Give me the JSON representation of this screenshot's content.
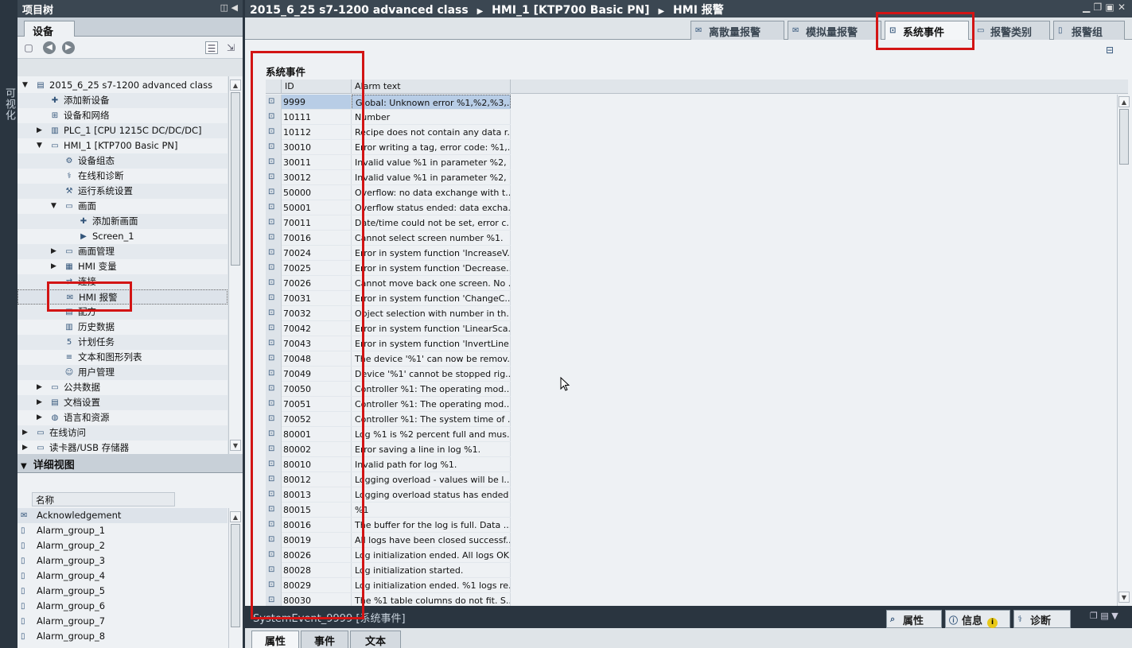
{
  "side_strip": {
    "label": "可视化"
  },
  "project_tree": {
    "title": "项目树",
    "tab": "设备",
    "nodes": [
      {
        "label": "2015_6_25 s7-1200 advanced class",
        "level": 0,
        "arrow": "▼",
        "icon": "project-icon"
      },
      {
        "label": "添加新设备",
        "level": 1,
        "arrow": "",
        "icon": "add-device-icon"
      },
      {
        "label": "设备和网络",
        "level": 1,
        "arrow": "",
        "icon": "network-icon"
      },
      {
        "label": "PLC_1 [CPU 1215C DC/DC/DC]",
        "level": 1,
        "arrow": "▶",
        "icon": "plc-icon"
      },
      {
        "label": "HMI_1 [KTP700 Basic PN]",
        "level": 1,
        "arrow": "▼",
        "icon": "hmi-icon"
      },
      {
        "label": "设备组态",
        "level": 2,
        "arrow": "",
        "icon": "device-config-icon"
      },
      {
        "label": "在线和诊断",
        "level": 2,
        "arrow": "",
        "icon": "diagnostics-icon"
      },
      {
        "label": "运行系统设置",
        "level": 2,
        "arrow": "",
        "icon": "runtime-settings-icon"
      },
      {
        "label": "画面",
        "level": 2,
        "arrow": "▼",
        "icon": "folder-icon"
      },
      {
        "label": "添加新画面",
        "level": 3,
        "arrow": "",
        "icon": "add-screen-icon"
      },
      {
        "label": "Screen_1",
        "level": 3,
        "arrow": "",
        "icon": "screen-icon"
      },
      {
        "label": "画面管理",
        "level": 2,
        "arrow": "▶",
        "icon": "folder-icon"
      },
      {
        "label": "HMI 变量",
        "level": 2,
        "arrow": "▶",
        "icon": "tags-icon"
      },
      {
        "label": "连接",
        "level": 2,
        "arrow": "",
        "icon": "connection-icon"
      },
      {
        "label": "HMI 报警",
        "level": 2,
        "arrow": "",
        "icon": "alarm-icon"
      },
      {
        "label": "配方",
        "level": 2,
        "arrow": "",
        "icon": "recipe-icon"
      },
      {
        "label": "历史数据",
        "level": 2,
        "arrow": "",
        "icon": "history-icon"
      },
      {
        "label": "计划任务",
        "level": 2,
        "arrow": "",
        "icon": "schedule-icon"
      },
      {
        "label": "文本和图形列表",
        "level": 2,
        "arrow": "",
        "icon": "text-list-icon"
      },
      {
        "label": "用户管理",
        "level": 2,
        "arrow": "",
        "icon": "user-admin-icon"
      },
      {
        "label": "公共数据",
        "level": 1,
        "arrow": "▶",
        "icon": "folder-icon"
      },
      {
        "label": "文档设置",
        "level": 1,
        "arrow": "▶",
        "icon": "document-settings-icon"
      },
      {
        "label": "语言和资源",
        "level": 1,
        "arrow": "▶",
        "icon": "language-icon"
      },
      {
        "label": "在线访问",
        "level": 0,
        "arrow": "▶",
        "icon": "online-access-icon"
      },
      {
        "label": "读卡器/USB 存储器",
        "level": 0,
        "arrow": "▶",
        "icon": "card-reader-icon"
      }
    ]
  },
  "detail_view": {
    "title": "详细视图",
    "column": "名称",
    "items": [
      "Acknowledgement",
      "Alarm_group_1",
      "Alarm_group_2",
      "Alarm_group_3",
      "Alarm_group_4",
      "Alarm_group_5",
      "Alarm_group_6",
      "Alarm_group_7",
      "Alarm_group_8"
    ]
  },
  "main": {
    "breadcrumb": [
      "2015_6_25 s7-1200 advanced class",
      "HMI_1 [KTP700 Basic PN]",
      "HMI 报警"
    ],
    "tabs": [
      {
        "label": "离散量报警",
        "active": false
      },
      {
        "label": "模拟量报警",
        "active": false
      },
      {
        "label": "系统事件",
        "active": true
      },
      {
        "label": "报警类别",
        "active": false
      },
      {
        "label": "报警组",
        "active": false
      }
    ],
    "section_title": "系统事件",
    "columns": {
      "id": "ID",
      "text": "Alarm text"
    },
    "rows": [
      {
        "id": "9999",
        "text": "Global: Unknown error %1,%2,%3,..."
      },
      {
        "id": "10111",
        "text": "Number"
      },
      {
        "id": "10112",
        "text": "Recipe does not contain any data r..."
      },
      {
        "id": "30010",
        "text": "Error writing a tag, error code: %1,..."
      },
      {
        "id": "30011",
        "text": "Invalid value %1 in parameter %2, ..."
      },
      {
        "id": "30012",
        "text": "Invalid value %1 in parameter %2, ..."
      },
      {
        "id": "50000",
        "text": "Overflow: no data exchange with t..."
      },
      {
        "id": "50001",
        "text": "Overflow status ended: data excha..."
      },
      {
        "id": "70011",
        "text": "Date/time could not be set, error c..."
      },
      {
        "id": "70016",
        "text": "Cannot select screen number %1."
      },
      {
        "id": "70024",
        "text": "Error in system function 'IncreaseV..."
      },
      {
        "id": "70025",
        "text": "Error in system function 'Decrease..."
      },
      {
        "id": "70026",
        "text": "Cannot move back one screen. No ..."
      },
      {
        "id": "70031",
        "text": "Error in system function 'ChangeC..."
      },
      {
        "id": "70032",
        "text": "Object selection with number in th..."
      },
      {
        "id": "70042",
        "text": "Error in system function 'LinearSca..."
      },
      {
        "id": "70043",
        "text": "Error in system function 'InvertLine..."
      },
      {
        "id": "70048",
        "text": "The device '%1' can now be remov..."
      },
      {
        "id": "70049",
        "text": "Device '%1' cannot be stopped rig..."
      },
      {
        "id": "70050",
        "text": "Controller %1: The operating mod..."
      },
      {
        "id": "70051",
        "text": "Controller %1: The operating mod..."
      },
      {
        "id": "70052",
        "text": "Controller %1: The system time of ..."
      },
      {
        "id": "80001",
        "text": "Log %1 is %2 percent full and mus..."
      },
      {
        "id": "80002",
        "text": "Error saving a line in log %1."
      },
      {
        "id": "80010",
        "text": "Invalid path for log %1."
      },
      {
        "id": "80012",
        "text": "Logging overload - values will be l..."
      },
      {
        "id": "80013",
        "text": "Logging overload status has ended"
      },
      {
        "id": "80015",
        "text": "%1"
      },
      {
        "id": "80016",
        "text": "The buffer for the log is full. Data ..."
      },
      {
        "id": "80019",
        "text": "All logs have been closed successf..."
      },
      {
        "id": "80026",
        "text": "Log initialization ended. All logs OK."
      },
      {
        "id": "80028",
        "text": "Log initialization started."
      },
      {
        "id": "80029",
        "text": "Log initialization ended. %1 logs re..."
      },
      {
        "id": "80030",
        "text": "The %1 table columns do not fit. S..."
      }
    ],
    "selected_row": 0
  },
  "inspector": {
    "caption": "SystemEvent_9999 [系统事件]",
    "right_tabs": [
      "属性",
      "信息",
      "诊断"
    ],
    "tabs": [
      "属性",
      "事件",
      "文本"
    ]
  },
  "colors": {
    "highlight": "#d21414",
    "selection": "#b8cde6",
    "titlebar": "#3b4752"
  }
}
